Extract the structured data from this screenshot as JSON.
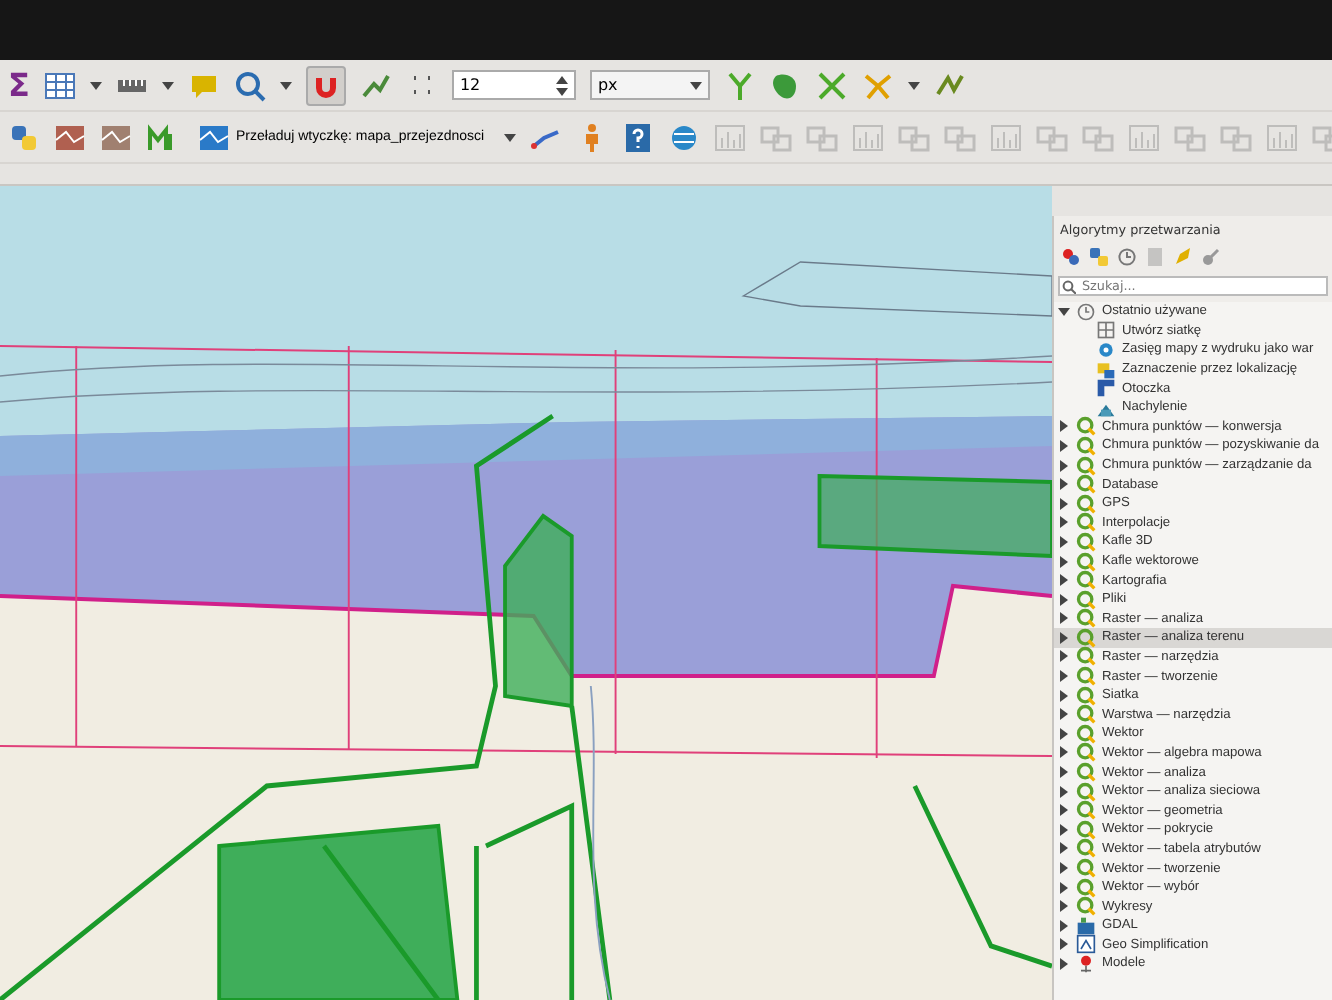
{
  "toolbar_1": {
    "sum_symbol": "Σ",
    "size_value": "12",
    "unit": "px"
  },
  "toolbar_2": {
    "plugin_reload": "Przeładuj wtyczkę: mapa_przejezdnosci"
  },
  "processing_panel": {
    "title": "Algorytmy przetwarzania",
    "search": {
      "placeholder": "Szukaj..."
    },
    "tree": [
      {
        "label": "Ostatnio używane",
        "kind": "recent",
        "expanded": true,
        "selected": false,
        "children": [
          {
            "label": "Utwórz siatkę",
            "kind": "grid",
            "selected": false
          },
          {
            "label": "Zasięg mapy z wydruku jako war",
            "kind": "gear",
            "selected": false
          },
          {
            "label": "Zaznaczenie przez lokalizację",
            "kind": "select",
            "selected": false
          },
          {
            "label": "Otoczka",
            "kind": "hull",
            "selected": false
          },
          {
            "label": "Nachylenie",
            "kind": "slope",
            "selected": false
          }
        ]
      },
      {
        "label": "Chmura punktów — konwersja",
        "kind": "qgis",
        "expanded": false,
        "selected": false
      },
      {
        "label": "Chmura punktów — pozyskiwanie da",
        "kind": "qgis",
        "expanded": false,
        "selected": false
      },
      {
        "label": "Chmura punktów — zarządzanie da",
        "kind": "qgis",
        "expanded": false,
        "selected": false
      },
      {
        "label": "Database",
        "kind": "qgis",
        "expanded": false,
        "selected": false
      },
      {
        "label": "GPS",
        "kind": "qgis",
        "expanded": false,
        "selected": false
      },
      {
        "label": "Interpolacje",
        "kind": "qgis",
        "expanded": false,
        "selected": false
      },
      {
        "label": "Kafle 3D",
        "kind": "qgis",
        "expanded": false,
        "selected": false
      },
      {
        "label": "Kafle wektorowe",
        "kind": "qgis",
        "expanded": false,
        "selected": false
      },
      {
        "label": "Kartografia",
        "kind": "qgis",
        "expanded": false,
        "selected": false
      },
      {
        "label": "Pliki",
        "kind": "qgis",
        "expanded": false,
        "selected": false
      },
      {
        "label": "Raster — analiza",
        "kind": "qgis",
        "expanded": false,
        "selected": false
      },
      {
        "label": "Raster — analiza terenu",
        "kind": "qgis",
        "expanded": false,
        "selected": true
      },
      {
        "label": "Raster — narzędzia",
        "kind": "qgis",
        "expanded": false,
        "selected": false
      },
      {
        "label": "Raster — tworzenie",
        "kind": "qgis",
        "expanded": false,
        "selected": false
      },
      {
        "label": "Siatka",
        "kind": "qgis",
        "expanded": false,
        "selected": false
      },
      {
        "label": "Warstwa — narzędzia",
        "kind": "qgis",
        "expanded": false,
        "selected": false
      },
      {
        "label": "Wektor",
        "kind": "qgis",
        "expanded": false,
        "selected": false
      },
      {
        "label": "Wektor — algebra mapowa",
        "kind": "qgis",
        "expanded": false,
        "selected": false
      },
      {
        "label": "Wektor — analiza",
        "kind": "qgis",
        "expanded": false,
        "selected": false
      },
      {
        "label": "Wektor — analiza sieciowa",
        "kind": "qgis",
        "expanded": false,
        "selected": false
      },
      {
        "label": "Wektor — geometria",
        "kind": "qgis",
        "expanded": false,
        "selected": false
      },
      {
        "label": "Wektor — pokrycie",
        "kind": "qgis",
        "expanded": false,
        "selected": false
      },
      {
        "label": "Wektor — tabela atrybutów",
        "kind": "qgis",
        "expanded": false,
        "selected": false
      },
      {
        "label": "Wektor — tworzenie",
        "kind": "qgis",
        "expanded": false,
        "selected": false
      },
      {
        "label": "Wektor — wybór",
        "kind": "qgis",
        "expanded": false,
        "selected": false
      },
      {
        "label": "Wykresy",
        "kind": "qgis",
        "expanded": false,
        "selected": false
      },
      {
        "label": "GDAL",
        "kind": "gdal",
        "expanded": false,
        "selected": false
      },
      {
        "label": "Geo Simplification",
        "kind": "geosimp",
        "expanded": false,
        "selected": false
      },
      {
        "label": "Modele",
        "kind": "model",
        "expanded": false,
        "selected": false
      }
    ]
  }
}
